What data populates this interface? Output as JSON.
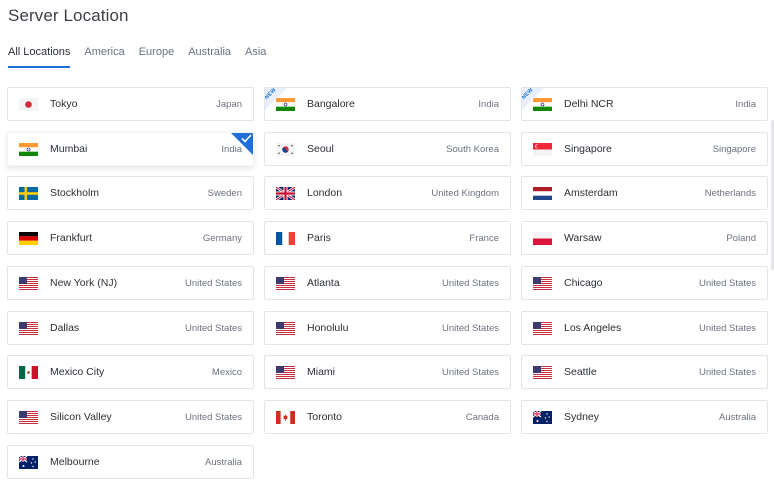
{
  "page": {
    "title": "Server Location",
    "tabs": [
      "All Locations",
      "America",
      "Europe",
      "Australia",
      "Asia"
    ],
    "active_tab": "All Locations"
  },
  "new_badge": "NEW",
  "locations": [
    {
      "city": "Tokyo",
      "country": "Japan",
      "flag": "jp-flag-icon",
      "new": false,
      "selected": false
    },
    {
      "city": "Bangalore",
      "country": "India",
      "flag": "in-flag-icon",
      "new": true,
      "selected": false
    },
    {
      "city": "Delhi NCR",
      "country": "India",
      "flag": "in-flag-icon",
      "new": true,
      "selected": false
    },
    {
      "city": "Mumbai",
      "country": "India",
      "flag": "in-flag-icon",
      "new": false,
      "selected": true
    },
    {
      "city": "Seoul",
      "country": "South Korea",
      "flag": "kr-flag-icon",
      "new": false,
      "selected": false
    },
    {
      "city": "Singapore",
      "country": "Singapore",
      "flag": "sg-flag-icon",
      "new": false,
      "selected": false
    },
    {
      "city": "Stockholm",
      "country": "Sweden",
      "flag": "se-flag-icon",
      "new": false,
      "selected": false
    },
    {
      "city": "London",
      "country": "United Kingdom",
      "flag": "gb-flag-icon",
      "new": false,
      "selected": false
    },
    {
      "city": "Amsterdam",
      "country": "Netherlands",
      "flag": "nl-flag-icon",
      "new": false,
      "selected": false
    },
    {
      "city": "Frankfurt",
      "country": "Germany",
      "flag": "de-flag-icon",
      "new": false,
      "selected": false
    },
    {
      "city": "Paris",
      "country": "France",
      "flag": "fr-flag-icon",
      "new": false,
      "selected": false
    },
    {
      "city": "Warsaw",
      "country": "Poland",
      "flag": "pl-flag-icon",
      "new": false,
      "selected": false
    },
    {
      "city": "New York (NJ)",
      "country": "United States",
      "flag": "us-flag-icon",
      "new": false,
      "selected": false
    },
    {
      "city": "Atlanta",
      "country": "United States",
      "flag": "us-flag-icon",
      "new": false,
      "selected": false
    },
    {
      "city": "Chicago",
      "country": "United States",
      "flag": "us-flag-icon",
      "new": false,
      "selected": false
    },
    {
      "city": "Dallas",
      "country": "United States",
      "flag": "us-flag-icon",
      "new": false,
      "selected": false
    },
    {
      "city": "Honolulu",
      "country": "United States",
      "flag": "us-flag-icon",
      "new": false,
      "selected": false
    },
    {
      "city": "Los Angeles",
      "country": "United States",
      "flag": "us-flag-icon",
      "new": false,
      "selected": false
    },
    {
      "city": "Mexico City",
      "country": "Mexico",
      "flag": "mx-flag-icon",
      "new": false,
      "selected": false
    },
    {
      "city": "Miami",
      "country": "United States",
      "flag": "us-flag-icon",
      "new": false,
      "selected": false
    },
    {
      "city": "Seattle",
      "country": "United States",
      "flag": "us-flag-icon",
      "new": false,
      "selected": false
    },
    {
      "city": "Silicon Valley",
      "country": "United States",
      "flag": "us-flag-icon",
      "new": false,
      "selected": false
    },
    {
      "city": "Toronto",
      "country": "Canada",
      "flag": "ca-flag-icon",
      "new": false,
      "selected": false
    },
    {
      "city": "Sydney",
      "country": "Australia",
      "flag": "au-flag-icon",
      "new": false,
      "selected": false
    },
    {
      "city": "Melbourne",
      "country": "Australia",
      "flag": "au-flag-icon",
      "new": false,
      "selected": false
    }
  ],
  "colors": {
    "accent": "#1e6fd9",
    "card_border": "#e1e4e8",
    "text_primary": "#2a2f36",
    "text_secondary": "#6b7280"
  }
}
